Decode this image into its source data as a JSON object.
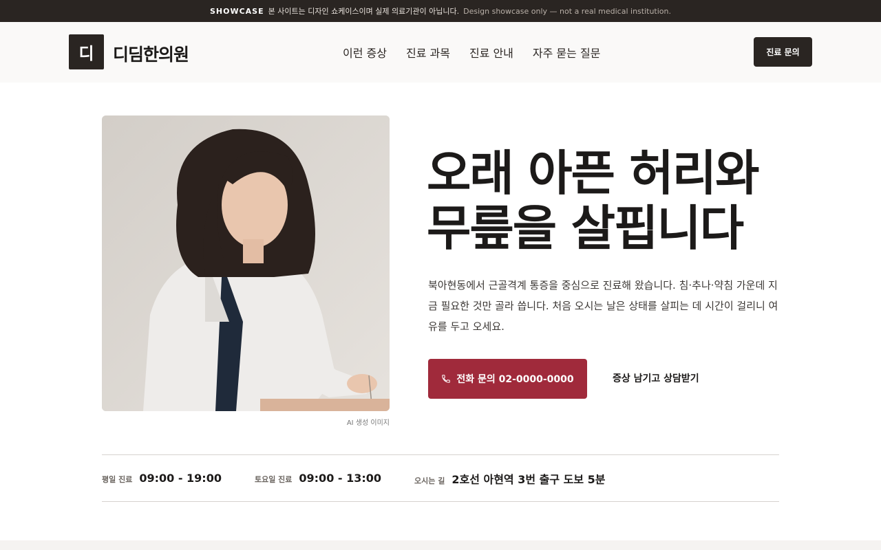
{
  "banner": {
    "tag": "SHOWCASE",
    "text_ko": "본 사이트는 디자인 쇼케이스이며 실제 의료기관이 아닙니다.",
    "text_en": "Design showcase only — not a real medical institution."
  },
  "header": {
    "logo_mark": "디",
    "logo_name": "디딤한의원",
    "nav": [
      "이런 증상",
      "진료 과목",
      "진료 안내",
      "자주 묻는 질문"
    ],
    "cta_label": "진료 문의"
  },
  "hero": {
    "image_caption": "AI 생성 이미지",
    "title_line1": "오래 아픈 허리와",
    "title_line2": "무릎을 살핍니다",
    "description": "북아현동에서 근골격계 통증을 중심으로 진료해 왔습니다. 침·추나·약침 가운데 지금 필요한 것만 골라 씁니다. 처음 오시는 날은 상태를 살피는 데 시간이 걸리니 여유를 두고 오세요.",
    "call_button": "전화 문의 02-0000-0000",
    "call_icon": "phone-icon",
    "secondary_link": "증상 남기고 상담받기"
  },
  "info": [
    {
      "label": "평일 진료",
      "value": "09:00 - 19:00"
    },
    {
      "label": "토요일 진료",
      "value": "09:00 - 13:00"
    },
    {
      "label": "오시는 길",
      "value": "2호선 아현역 3번 출구 도보 5분"
    }
  ],
  "colors": {
    "dark": "#2a2522",
    "accent": "#a02a3b",
    "background": "#ffffff"
  }
}
